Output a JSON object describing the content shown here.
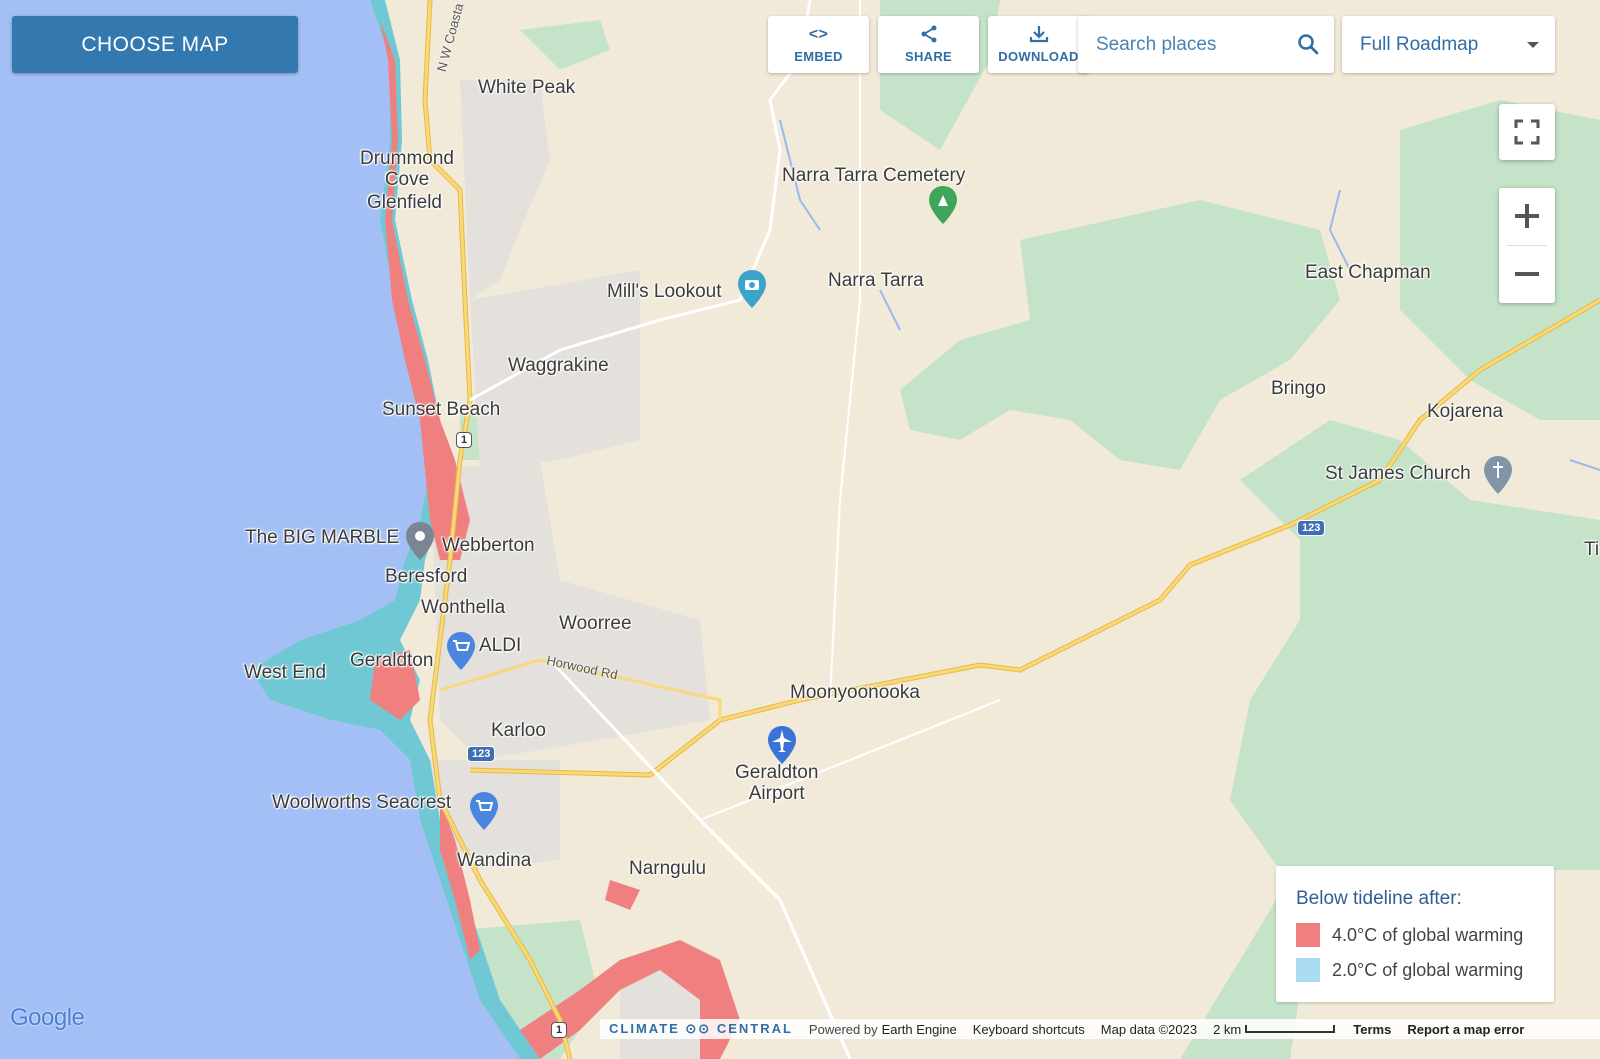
{
  "toolbar": {
    "choose_map": "CHOOSE MAP",
    "embed": "EMBED",
    "share": "SHARE",
    "download": "DOWNLOAD",
    "search_placeholder": "Search places",
    "map_type": "Full Roadmap"
  },
  "places": {
    "white_peak": "White Peak",
    "drummond_cove": "Drummond\nCove",
    "glenfield": "Glenfield",
    "narra_tarra_cemetery": "Narra Tarra Cemetery",
    "mills_lookout": "Mill's Lookout",
    "narra_tarra": "Narra Tarra",
    "east_chapman": "East Chapman",
    "waggrakine": "Waggrakine",
    "bringo": "Bringo",
    "kojarena": "Kojarena",
    "sunset_beach": "Sunset Beach",
    "st_james_church": "St James Church",
    "big_marble": "The BIG MARBLE",
    "webberton": "Webberton",
    "beresford": "Beresford",
    "wonthella": "Wonthella",
    "woorree": "Woorree",
    "aldi": "ALDI",
    "west_end": "West End",
    "geraldton": "Geraldton",
    "moonyoonooka": "Moonyoonooka",
    "karloo": "Karloo",
    "geraldton_airport": "Geraldton\nAirport",
    "woolworths": "Woolworths Seacrest",
    "wandina": "Wandina",
    "narngulu": "Narngulu",
    "ti": "Ti"
  },
  "roads": {
    "nw_coastal": "N W Coasta",
    "horwood": "Horwood Rd",
    "hwy1": "1",
    "hwy123": "123"
  },
  "legend": {
    "title": "Below tideline after:",
    "items": [
      {
        "label": "4.0°C of global warming",
        "color": "#f08080"
      },
      {
        "label": "2.0°C of global warming",
        "color": "#a9dcf2"
      }
    ]
  },
  "footer": {
    "brand": "CLIMATE ⊙⊙ CENTRAL",
    "powered": "Powered by",
    "engine": "Earth Engine",
    "shortcuts": "Keyboard shortcuts",
    "map_data": "Map data ©2023",
    "scale": "2 km",
    "terms": "Terms",
    "report": "Report a map error"
  },
  "google_logo": "Google",
  "colors": {
    "ocean": "#a3bff5",
    "land": "#f2ead9",
    "park": "#bfe0c4",
    "urban": "#e6e3df",
    "coast_2c": "#6fc8d4",
    "coast_4c": "#f08080",
    "road_major": "#f5cf6a",
    "accent": "#3379b0"
  }
}
